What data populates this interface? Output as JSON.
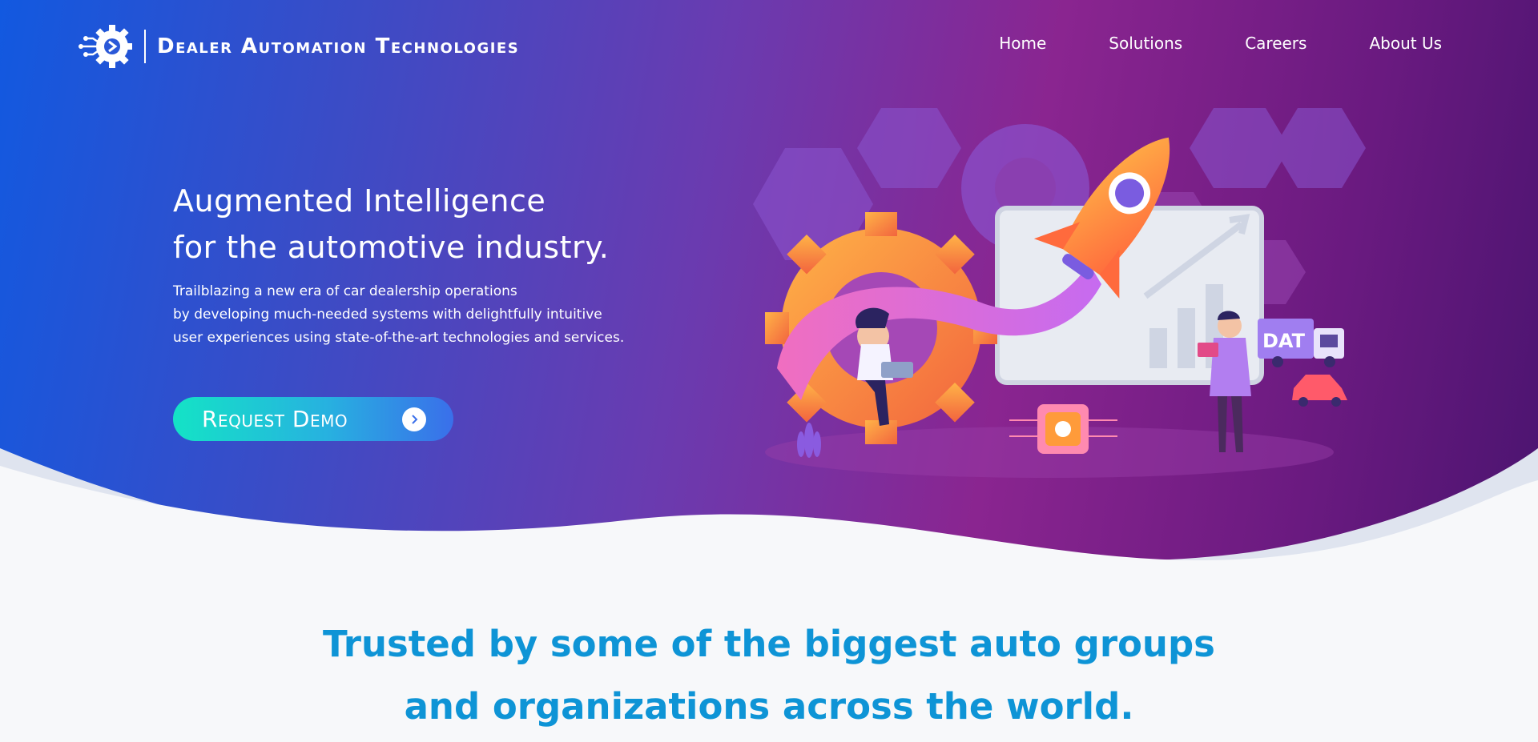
{
  "brand": {
    "name": "Dealer Automation Technologies"
  },
  "nav": {
    "items": [
      "Home",
      "Solutions",
      "Careers",
      "About Us"
    ]
  },
  "hero": {
    "headline": [
      "Augmented Intelligence",
      "for the automotive industry."
    ],
    "subtext": [
      "Trailblazing a new era of car dealership operations",
      "by developing much-needed systems with delightfully intuitive",
      "user experiences using state-of-the-art technologies and services."
    ],
    "cta_label": "Request Demo",
    "truck_label": "DAT"
  },
  "trusted": {
    "lines": [
      "Trusted by some of the biggest auto groups",
      "and organizations across the world."
    ]
  },
  "colors": {
    "hero_gradient": [
      "#1259e0",
      "#6a3bb0",
      "#8a2590",
      "#4b1470"
    ],
    "accent_blue": "#0e94d6",
    "cta_gradient": [
      "#14e3c6",
      "#3a6fea"
    ],
    "page_background": "#f7f8fa"
  },
  "icons": [
    "gear-circuit-logo-icon",
    "chevron-right-icon"
  ]
}
